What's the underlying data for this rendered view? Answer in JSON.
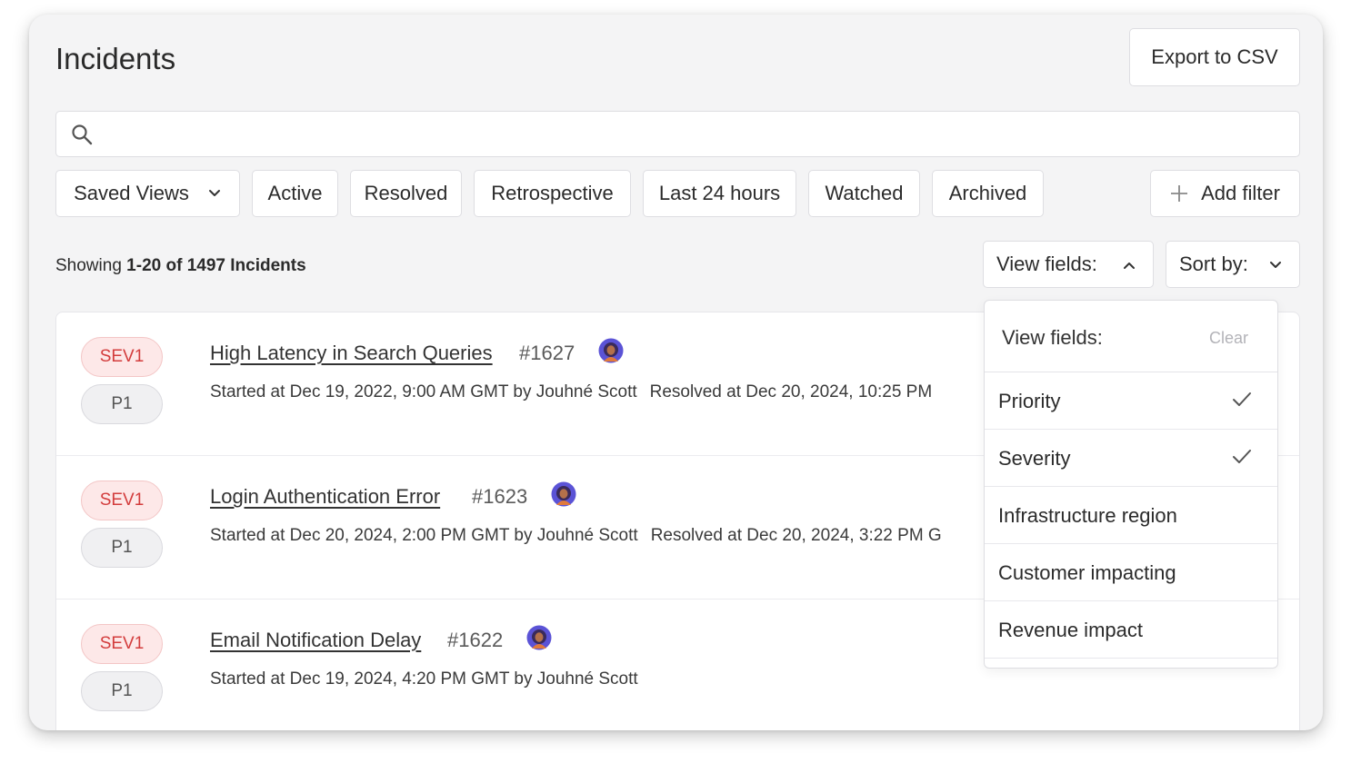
{
  "header": {
    "title": "Incidents",
    "export_label": "Export to CSV"
  },
  "search": {
    "placeholder": ""
  },
  "filters": {
    "saved_views": "Saved Views",
    "chips": [
      "Active",
      "Resolved",
      "Retrospective",
      "Last 24 hours",
      "Watched",
      "Archived"
    ],
    "add_filter": "Add filter"
  },
  "summary": {
    "prefix": "Showing",
    "range": "1-20 of 1497 Incidents"
  },
  "controls": {
    "view_fields": "View fields:",
    "sort_by": "Sort by:"
  },
  "incidents": [
    {
      "severity": "SEV1",
      "priority": "P1",
      "title": "High Latency in Search Queries",
      "number": "#1627",
      "started": "Started at Dec 19, 2022, 9:00 AM GMT by Jouhné Scott",
      "resolved": "Resolved at Dec 20, 2024, 10:25 PM"
    },
    {
      "severity": "SEV1",
      "priority": "P1",
      "title": "Login Authentication Error",
      "number": "#1623",
      "started": "Started at Dec 20, 2024, 2:00 PM GMT by Jouhné Scott",
      "resolved": "Resolved at Dec 20, 2024, 3:22 PM G"
    },
    {
      "severity": "SEV1",
      "priority": "P1",
      "title": "Email Notification Delay",
      "number": "#1622",
      "started": "Started at Dec 19, 2024, 4:20 PM GMT by Jouhné Scott",
      "resolved": ""
    }
  ],
  "view_fields_menu": {
    "title": "View fields:",
    "clear": "Clear",
    "items": [
      {
        "label": "Priority",
        "checked": true
      },
      {
        "label": "Severity",
        "checked": true
      },
      {
        "label": "Infrastructure region",
        "checked": false
      },
      {
        "label": "Customer impacting",
        "checked": false
      },
      {
        "label": "Revenue impact",
        "checked": false
      }
    ]
  },
  "colors": {
    "sev_bg": "#fde8e8",
    "sev_text": "#d33d3d",
    "pri_bg": "#f0f0f2",
    "avatar_ring": "#5b53d6"
  }
}
